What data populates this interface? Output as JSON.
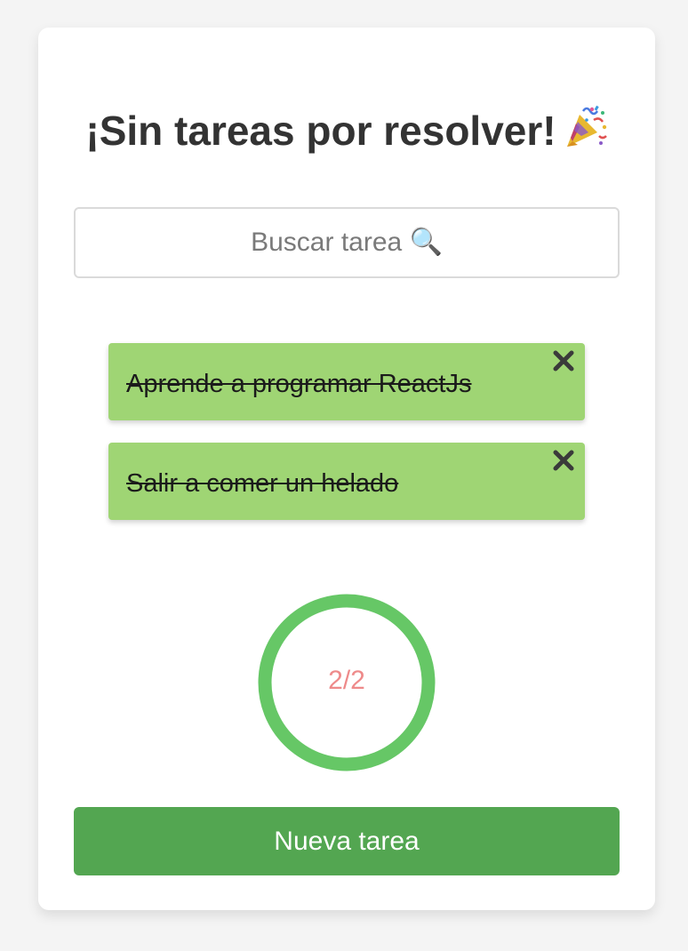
{
  "header": {
    "title": "¡Sin tareas por resolver!",
    "title_icon": "party-popper-icon"
  },
  "search": {
    "placeholder": "Buscar tarea 🔍",
    "value": ""
  },
  "todos": [
    {
      "text": "Aprende a programar ReactJs",
      "completed": true,
      "close_icon": "close-icon"
    },
    {
      "text": "Salir a comer un helado",
      "completed": true,
      "close_icon": "close-icon"
    }
  ],
  "counter": {
    "label": "2/2",
    "completed": 2,
    "total": 2,
    "ring_color": "#66c766",
    "label_color": "#ee8a8a"
  },
  "actions": {
    "new_task_label": "Nueva tarea"
  },
  "colors": {
    "todo_background": "#9fd574",
    "button_background": "#53a651",
    "page_background": "#f4f4f4"
  }
}
